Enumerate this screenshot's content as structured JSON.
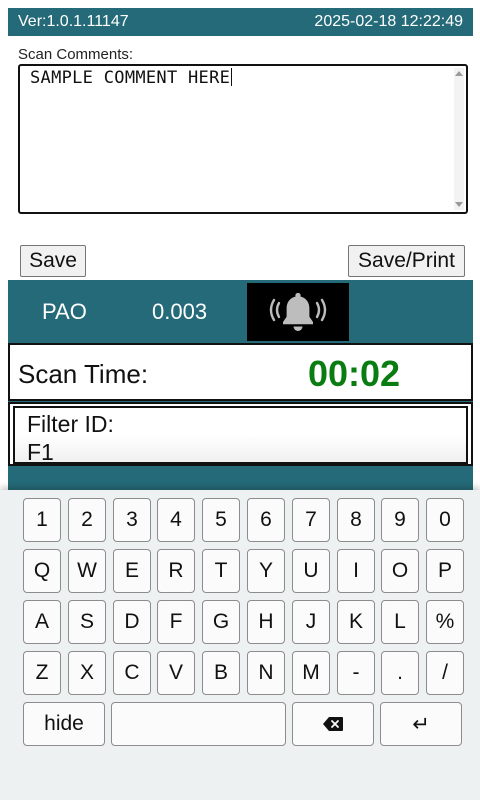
{
  "header": {
    "version": "Ver:1.0.1.11147",
    "datetime": "2025-02-18 12:22:49"
  },
  "comments": {
    "label": "Scan Comments:",
    "value": "SAMPLE COMMENT HERE"
  },
  "buttons": {
    "save": "Save",
    "save_print": "Save/Print"
  },
  "reading": {
    "gas_label": "PAO",
    "gas_value": "0.003",
    "alarm_icon": "bell-ringing-icon"
  },
  "scan": {
    "label": "Scan Time:",
    "value": "00:02",
    "value_color": "#0a7d12"
  },
  "filter": {
    "label": "Filter ID:",
    "value": "F1"
  },
  "keyboard": {
    "rows": [
      [
        "1",
        "2",
        "3",
        "4",
        "5",
        "6",
        "7",
        "8",
        "9",
        "0"
      ],
      [
        "Q",
        "W",
        "E",
        "R",
        "T",
        "Y",
        "U",
        "I",
        "O",
        "P"
      ],
      [
        "A",
        "S",
        "D",
        "F",
        "G",
        "H",
        "J",
        "K",
        "L",
        "%"
      ],
      [
        "Z",
        "X",
        "C",
        "V",
        "B",
        "N",
        "M",
        "-",
        ".",
        "/"
      ]
    ],
    "hide_label": "hide",
    "backspace_icon": "backspace-icon",
    "enter_label": "↵"
  },
  "colors": {
    "accent": "#256a78",
    "alarm_bg": "#000000",
    "alarm_icon": "#bdbdbd"
  }
}
